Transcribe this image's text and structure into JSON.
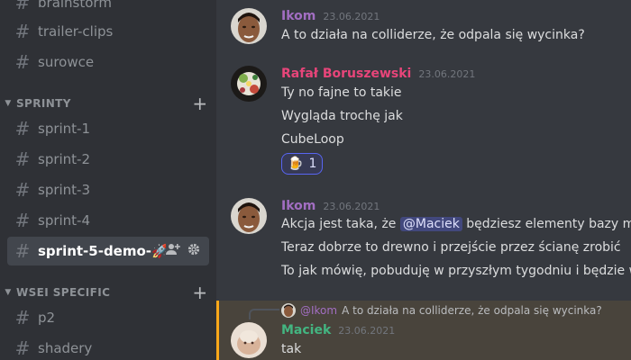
{
  "sidebar": {
    "channels_top": [
      {
        "name": "brainstorm"
      },
      {
        "name": "trailer-clips"
      },
      {
        "name": "surowce"
      }
    ],
    "categories": [
      {
        "label": "SPRINTY"
      },
      {
        "label": "WSEI SPECIFIC"
      }
    ],
    "sprint_channels": [
      {
        "name": "sprint-1"
      },
      {
        "name": "sprint-2"
      },
      {
        "name": "sprint-3"
      },
      {
        "name": "sprint-4"
      },
      {
        "name": "sprint-5-demo-🚀"
      }
    ],
    "wsei_channels": [
      {
        "name": "p2"
      },
      {
        "name": "shadery"
      }
    ],
    "hash_glyph": "#",
    "plus_glyph": "+",
    "active_channel": "sprint-5-demo-🚀"
  },
  "messages": [
    {
      "author": "Ikom",
      "author_color": "#a26ec2",
      "timestamp": "23.06.2021",
      "lines": [
        "A to działa na colliderze, że odpala się wycinka?"
      ]
    },
    {
      "author": "Rafał Boruszewski",
      "author_color": "#e8457a",
      "timestamp": "23.06.2021",
      "lines": [
        "Ty no fajne to takie",
        "Wygląda trochę jak",
        "CubeLoop"
      ],
      "reaction": {
        "emoji": "🍺",
        "count": "1"
      }
    },
    {
      "author": "Ikom",
      "author_color": "#a26ec2",
      "timestamp": "23.06.2021",
      "line1_before": "Akcja jest taka, że ",
      "line1_mention": "@Maciek",
      "line1_after": " będziesz elementy bazy musi",
      "lines": [
        "Teraz dobrze to drewno i przejście przez ścianę zrobić",
        "To jak mówię, pobuduję w przyszłym tygodniu i będzie w p"
      ]
    },
    {
      "author": "Maciek",
      "author_color": "#43b581",
      "timestamp": "23.06.2021",
      "reply_to_name": "@Ikom",
      "reply_to_text": "A to działa na colliderze, że odpala się wycinka?",
      "lines": [
        "tak"
      ]
    }
  ],
  "colors": {
    "sidebar_bg": "#2f3136",
    "chat_bg": "#36393f",
    "highlight_border": "#faa81a"
  }
}
